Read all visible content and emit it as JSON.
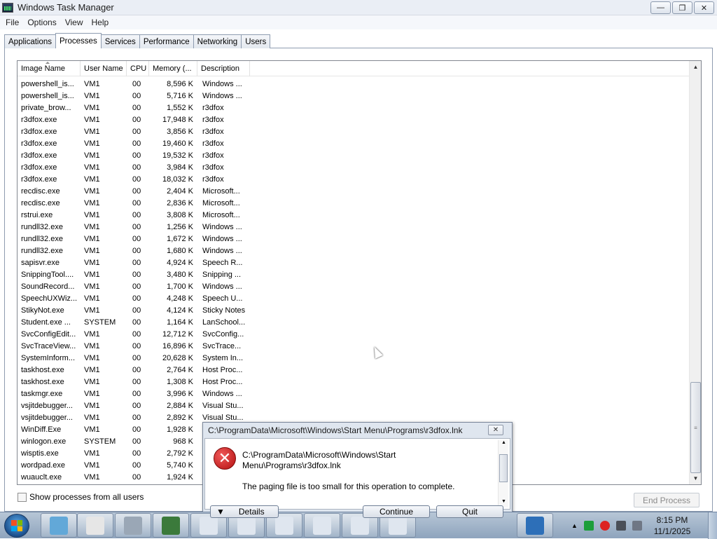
{
  "window": {
    "title": "Windows Task Manager",
    "buttons": {
      "minimize": "—",
      "maximize": "❐",
      "close": "✕"
    }
  },
  "menu": [
    "File",
    "Options",
    "View",
    "Help"
  ],
  "tabs": [
    "Applications",
    "Processes",
    "Services",
    "Performance",
    "Networking",
    "Users"
  ],
  "active_tab": "Processes",
  "columns": [
    "Image Name",
    "User Name",
    "CPU",
    "Memory (...",
    "Description"
  ],
  "processes": [
    {
      "name": "powershell_is...",
      "user": "VM1",
      "cpu": "00",
      "mem": "8,596 K",
      "desc": "Windows ..."
    },
    {
      "name": "powershell_is...",
      "user": "VM1",
      "cpu": "00",
      "mem": "5,716 K",
      "desc": "Windows ..."
    },
    {
      "name": "private_brow...",
      "user": "VM1",
      "cpu": "00",
      "mem": "1,552 K",
      "desc": "r3dfox"
    },
    {
      "name": "r3dfox.exe",
      "user": "VM1",
      "cpu": "00",
      "mem": "17,948 K",
      "desc": "r3dfox"
    },
    {
      "name": "r3dfox.exe",
      "user": "VM1",
      "cpu": "00",
      "mem": "3,856 K",
      "desc": "r3dfox"
    },
    {
      "name": "r3dfox.exe",
      "user": "VM1",
      "cpu": "00",
      "mem": "19,460 K",
      "desc": "r3dfox"
    },
    {
      "name": "r3dfox.exe",
      "user": "VM1",
      "cpu": "00",
      "mem": "19,532 K",
      "desc": "r3dfox"
    },
    {
      "name": "r3dfox.exe",
      "user": "VM1",
      "cpu": "00",
      "mem": "3,984 K",
      "desc": "r3dfox"
    },
    {
      "name": "r3dfox.exe",
      "user": "VM1",
      "cpu": "00",
      "mem": "18,032 K",
      "desc": "r3dfox"
    },
    {
      "name": "recdisc.exe",
      "user": "VM1",
      "cpu": "00",
      "mem": "2,404 K",
      "desc": "Microsoft..."
    },
    {
      "name": "recdisc.exe",
      "user": "VM1",
      "cpu": "00",
      "mem": "2,836 K",
      "desc": "Microsoft..."
    },
    {
      "name": "rstrui.exe",
      "user": "VM1",
      "cpu": "00",
      "mem": "3,808 K",
      "desc": "Microsoft..."
    },
    {
      "name": "rundll32.exe",
      "user": "VM1",
      "cpu": "00",
      "mem": "1,256 K",
      "desc": "Windows ..."
    },
    {
      "name": "rundll32.exe",
      "user": "VM1",
      "cpu": "00",
      "mem": "1,672 K",
      "desc": "Windows ..."
    },
    {
      "name": "rundll32.exe",
      "user": "VM1",
      "cpu": "00",
      "mem": "1,680 K",
      "desc": "Windows ..."
    },
    {
      "name": "sapisvr.exe",
      "user": "VM1",
      "cpu": "00",
      "mem": "4,924 K",
      "desc": "Speech R..."
    },
    {
      "name": "SnippingTool....",
      "user": "VM1",
      "cpu": "00",
      "mem": "3,480 K",
      "desc": "Snipping ..."
    },
    {
      "name": "SoundRecord...",
      "user": "VM1",
      "cpu": "00",
      "mem": "1,700 K",
      "desc": "Windows ..."
    },
    {
      "name": "SpeechUXWiz...",
      "user": "VM1",
      "cpu": "00",
      "mem": "4,248 K",
      "desc": "Speech U..."
    },
    {
      "name": "StikyNot.exe",
      "user": "VM1",
      "cpu": "00",
      "mem": "4,124 K",
      "desc": "Sticky Notes"
    },
    {
      "name": "Student.exe ...",
      "user": "SYSTEM",
      "cpu": "00",
      "mem": "1,164 K",
      "desc": "LanSchool..."
    },
    {
      "name": "SvcConfigEdit...",
      "user": "VM1",
      "cpu": "00",
      "mem": "12,712 K",
      "desc": "SvcConfig..."
    },
    {
      "name": "SvcTraceView...",
      "user": "VM1",
      "cpu": "00",
      "mem": "16,896 K",
      "desc": "SvcTrace..."
    },
    {
      "name": "SystemInform...",
      "user": "VM1",
      "cpu": "00",
      "mem": "20,628 K",
      "desc": "System In..."
    },
    {
      "name": "taskhost.exe",
      "user": "VM1",
      "cpu": "00",
      "mem": "2,764 K",
      "desc": "Host Proc..."
    },
    {
      "name": "taskhost.exe",
      "user": "VM1",
      "cpu": "00",
      "mem": "1,308 K",
      "desc": "Host Proc..."
    },
    {
      "name": "taskmgr.exe",
      "user": "VM1",
      "cpu": "00",
      "mem": "3,996 K",
      "desc": "Windows ..."
    },
    {
      "name": "vsjitdebugger...",
      "user": "VM1",
      "cpu": "00",
      "mem": "2,884 K",
      "desc": "Visual Stu..."
    },
    {
      "name": "vsjitdebugger...",
      "user": "VM1",
      "cpu": "00",
      "mem": "2,892 K",
      "desc": "Visual Stu..."
    },
    {
      "name": "WinDiff.Exe",
      "user": "VM1",
      "cpu": "00",
      "mem": "1,928 K",
      "desc": ""
    },
    {
      "name": "winlogon.exe",
      "user": "SYSTEM",
      "cpu": "00",
      "mem": "968 K",
      "desc": ""
    },
    {
      "name": "wisptis.exe",
      "user": "VM1",
      "cpu": "00",
      "mem": "2,792 K",
      "desc": ""
    },
    {
      "name": "wordpad.exe",
      "user": "VM1",
      "cpu": "00",
      "mem": "5,740 K",
      "desc": ""
    },
    {
      "name": "wuauclt.exe",
      "user": "VM1",
      "cpu": "00",
      "mem": "1,924 K",
      "desc": ""
    }
  ],
  "footer": {
    "show_all_label": "Show processes from all users",
    "end_process_label": "End Process"
  },
  "dialog": {
    "title": "C:\\ProgramData\\Microsoft\\Windows\\Start Menu\\Programs\\r3dfox.lnk",
    "path": "C:\\ProgramData\\Microsoft\\Windows\\Start Menu\\Programs\\r3dfox.lnk",
    "message": "The paging file is too small for this operation to complete.",
    "details_label": "Details",
    "continue_label": "Continue",
    "quit_label": "Quit",
    "close_glyph": "✕",
    "error_glyph": "✕"
  },
  "taskbar": {
    "pinned": [
      "control-panel-icon",
      "clock-icon",
      "printer-icon",
      "chart-icon",
      "window-icon",
      "window-icon",
      "window-icon",
      "window-icon",
      "window-icon",
      "window-icon",
      "wordpad-icon"
    ],
    "time": "8:15 PM",
    "date": "11/1/2025"
  },
  "colors": {
    "accent": "#1b4f8c",
    "error_red": "#c81a1a",
    "tab_border": "#8e9cb0"
  }
}
